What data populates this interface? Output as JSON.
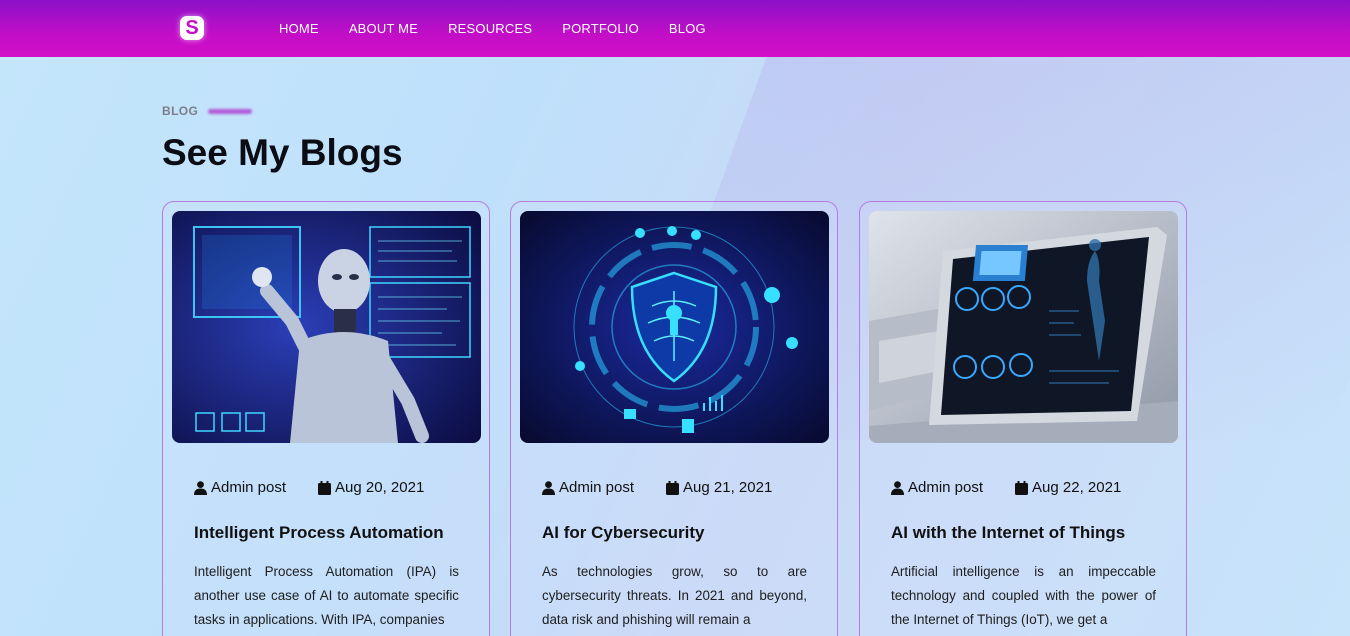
{
  "nav": {
    "logo_letter": "S",
    "links": [
      "HOME",
      "ABOUT ME",
      "RESOURCES",
      "PORTFOLIO",
      "BLOG"
    ]
  },
  "section": {
    "eyebrow": "BLOG",
    "title": "See My Blogs"
  },
  "posts": [
    {
      "image": "robot-hologram-image",
      "author": "Admin post",
      "date": "Aug 20, 2021",
      "title": "Intelligent Process Automation",
      "excerpt": "Intelligent Process Automation (IPA) is another use case of AI to automate specific tasks in applications. With IPA, companies"
    },
    {
      "image": "cyber-shield-image",
      "author": "Admin post",
      "date": "Aug 21, 2021",
      "title": "AI for Cybersecurity",
      "excerpt": "As technologies grow, so to are cybersecurity threats. In 2021 and beyond, data risk and phishing will remain a"
    },
    {
      "image": "medical-tablet-image",
      "author": "Admin post",
      "date": "Aug 22, 2021",
      "title": "AI with the Internet of Things",
      "excerpt": "Artificial intelligence is an impeccable technology and coupled with the power of the Internet of Things (IoT), we get a"
    }
  ],
  "colors": {
    "nav_gradient_start": "#8a12c8",
    "nav_gradient_end": "#d40fc8",
    "card_border": "#b67be2",
    "accent": "#b25ad8"
  }
}
